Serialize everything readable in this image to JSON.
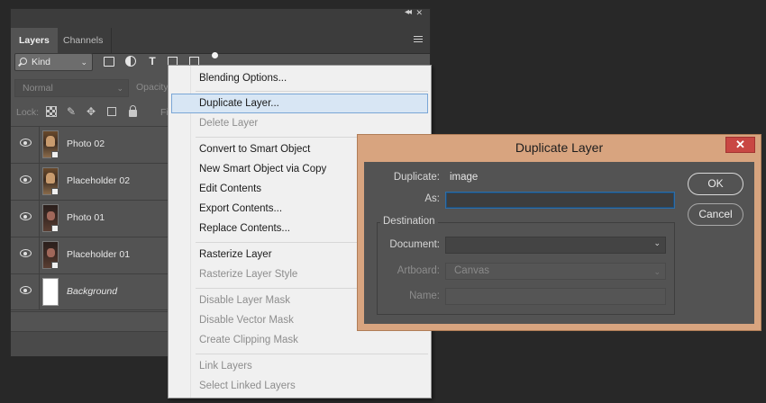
{
  "panel": {
    "tabs": [
      "Layers",
      "Channels"
    ],
    "kind_filter": "Kind",
    "blend_mode": "Normal",
    "opacity_label": "Opacity",
    "lock_label": "Lock:",
    "fill_label": "Fill",
    "layers": [
      {
        "name": "Photo 02",
        "thumb": "photo"
      },
      {
        "name": "Placeholder 02",
        "thumb": "photo"
      },
      {
        "name": "Photo 01",
        "thumb": "dark"
      },
      {
        "name": "Placeholder 01",
        "thumb": "dark"
      },
      {
        "name": "Background",
        "thumb": "white"
      }
    ],
    "icons": [
      "double-chevron-icon",
      "close-icon",
      "panel-menu-icon",
      "search-icon",
      "image-filter-icon",
      "adjustment-filter-icon",
      "type-filter-icon",
      "shape-filter-icon",
      "smart-object-filter-icon",
      "filter-toggle-icon",
      "lock-transparent-icon",
      "brush-icon",
      "move-icon",
      "crop-icon",
      "lock-icon",
      "eye-icon"
    ]
  },
  "context_menu": {
    "items": [
      {
        "label": "Blending Options...",
        "enabled": true
      },
      {
        "label": "Duplicate Layer...",
        "enabled": true,
        "highlighted": true
      },
      {
        "label": "Delete Layer",
        "enabled": false
      },
      {
        "label": "Convert to Smart Object",
        "enabled": true
      },
      {
        "label": "New Smart Object via Copy",
        "enabled": true
      },
      {
        "label": "Edit Contents",
        "enabled": true
      },
      {
        "label": "Export Contents...",
        "enabled": true
      },
      {
        "label": "Replace Contents...",
        "enabled": true
      },
      {
        "label": "Rasterize Layer",
        "enabled": true
      },
      {
        "label": "Rasterize Layer Style",
        "enabled": false
      },
      {
        "label": "Disable Layer Mask",
        "enabled": false
      },
      {
        "label": "Disable Vector Mask",
        "enabled": false
      },
      {
        "label": "Create Clipping Mask",
        "enabled": false
      },
      {
        "label": "Link Layers",
        "enabled": false
      },
      {
        "label": "Select Linked Layers",
        "enabled": false
      }
    ]
  },
  "dialog": {
    "title": "Duplicate Layer",
    "close_label": "✕",
    "duplicate_label": "Duplicate:",
    "duplicate_value": "image",
    "as_label": "As:",
    "as_value": "",
    "destination_legend": "Destination",
    "document_label": "Document:",
    "document_value": "",
    "artboard_label": "Artboard:",
    "artboard_value": "Canvas",
    "name_label": "Name:",
    "name_value": "",
    "ok_label": "OK",
    "cancel_label": "Cancel"
  },
  "colors": {
    "background": "#282828",
    "panel": "#535353",
    "dialog_frame": "#d8a47f",
    "menu_highlight": "#d8e6f4",
    "close_button": "#c94743"
  }
}
